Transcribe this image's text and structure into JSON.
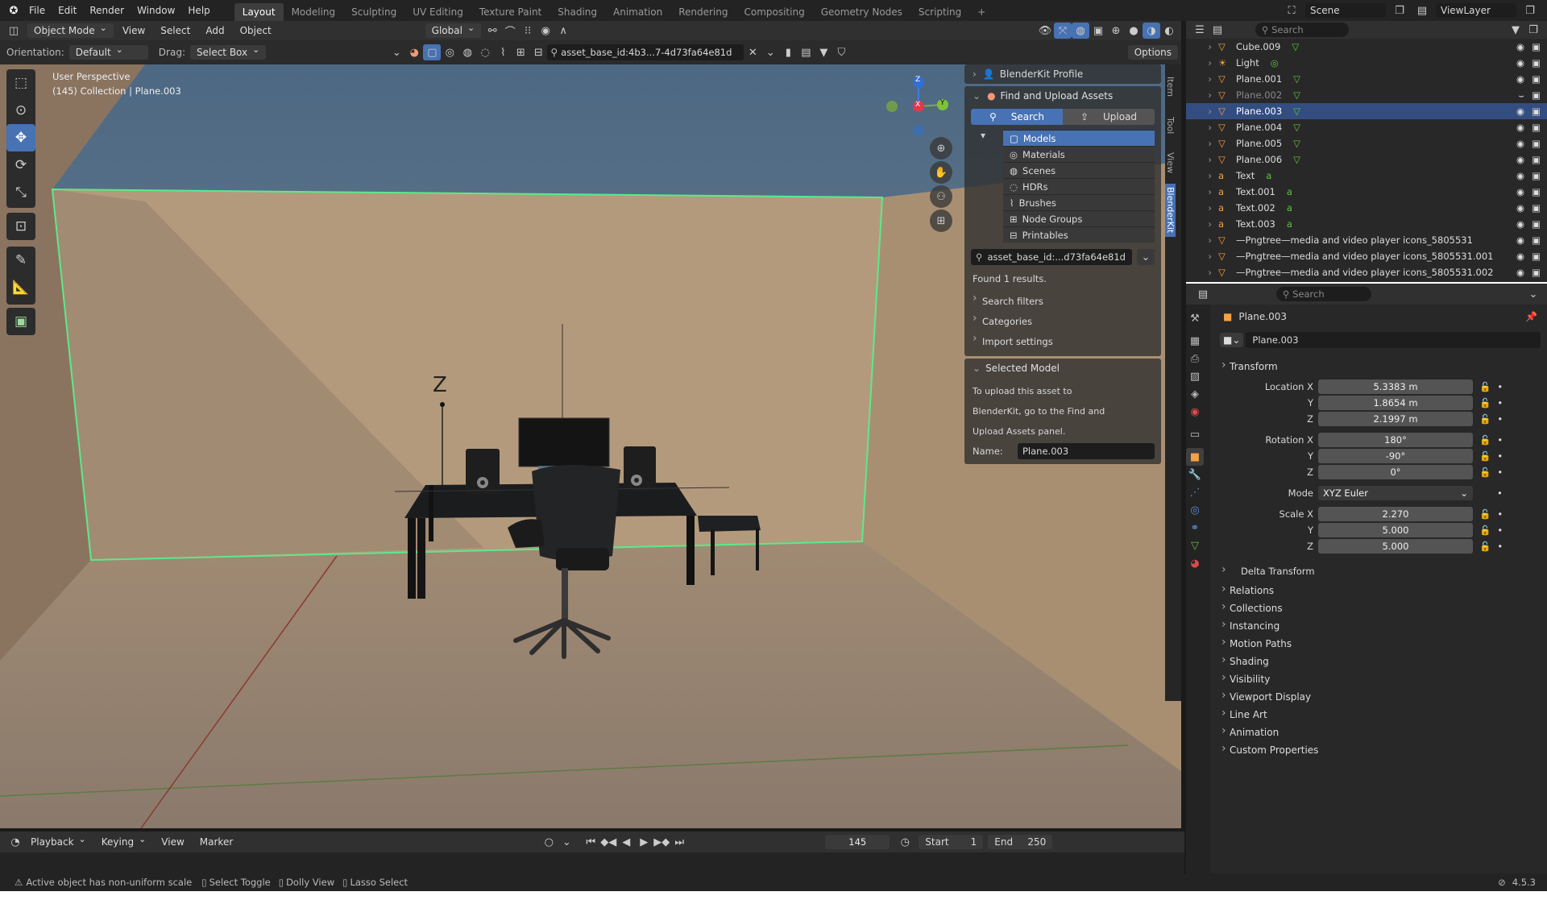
{
  "topbar": {
    "menus": [
      "File",
      "Edit",
      "Render",
      "Window",
      "Help"
    ],
    "workspaces": [
      "Layout",
      "Modeling",
      "Sculpting",
      "UV Editing",
      "Texture Paint",
      "Shading",
      "Animation",
      "Rendering",
      "Compositing",
      "Geometry Nodes",
      "Scripting"
    ],
    "active_workspace": "Layout",
    "add_tab": "+",
    "scene_label": "Scene",
    "viewlayer_label": "ViewLayer"
  },
  "viewport_header": {
    "mode": "Object Mode",
    "menus": [
      "View",
      "Select",
      "Add",
      "Object"
    ],
    "transform_orientation": "Global",
    "orientation_label": "Orientation:",
    "orientation_value": "Default",
    "drag_label": "Drag:",
    "drag_value": "Select Box",
    "search_text": "asset_base_id:4b3...7-4d73fa64e81d",
    "options": "Options"
  },
  "viewport": {
    "perspective": "User Perspective",
    "collection_info": "(145) Collection | Plane.003",
    "z_label": "Z",
    "gizmo_x": "X",
    "gizmo_y": "Y",
    "gizmo_z": "Z"
  },
  "sidebar_tabs": [
    "Item",
    "Tool",
    "View",
    "BlenderKit"
  ],
  "blenderkit": {
    "profile_label": "BlenderKit Profile",
    "find_upload_label": "Find and Upload Assets",
    "search_tab": "Search",
    "upload_tab": "Upload",
    "categories": [
      "Models",
      "Materials",
      "Scenes",
      "HDRs",
      "Brushes",
      "Node Groups",
      "Printables"
    ],
    "active_category": "Models",
    "search_value": "asset_base_id:...d73fa64e81d",
    "results_text": "Found 1 results.",
    "search_filters": "Search filters",
    "categories_label": "Categories",
    "import_settings": "Import settings",
    "selected_model_label": "Selected Model",
    "upload_info_1": "To upload this asset to",
    "upload_info_2": "BlenderKit, go to the Find and",
    "upload_info_3": "Upload Assets panel.",
    "name_label": "Name:",
    "name_value": "Plane.003"
  },
  "outliner": {
    "search_placeholder": "Search",
    "items": [
      {
        "name": "Cube.009",
        "type": "mesh"
      },
      {
        "name": "Light",
        "type": "light"
      },
      {
        "name": "Plane.001",
        "type": "mesh"
      },
      {
        "name": "Plane.002",
        "type": "mesh",
        "dim": true
      },
      {
        "name": "Plane.003",
        "type": "mesh",
        "selected": true
      },
      {
        "name": "Plane.004",
        "type": "mesh"
      },
      {
        "name": "Plane.005",
        "type": "mesh"
      },
      {
        "name": "Plane.006",
        "type": "mesh"
      },
      {
        "name": "Text",
        "type": "text"
      },
      {
        "name": "Text.001",
        "type": "text"
      },
      {
        "name": "Text.002",
        "type": "text"
      },
      {
        "name": "Text.003",
        "type": "text"
      },
      {
        "name": "—Pngtree—media and video player icons_5805531",
        "type": "mesh"
      },
      {
        "name": "—Pngtree—media and video player icons_5805531.001",
        "type": "mesh"
      },
      {
        "name": "—Pngtree—media and video player icons_5805531.002",
        "type": "mesh"
      }
    ]
  },
  "properties": {
    "search_placeholder": "Search",
    "object_name": "Plane.003",
    "object_field": "Plane.003",
    "transform_label": "Transform",
    "location_label": "Location X",
    "location": [
      "5.3383 m",
      "1.8654 m",
      "2.1997 m"
    ],
    "rotation_label": "Rotation X",
    "rotation": [
      "180°",
      "-90°",
      "0°"
    ],
    "axis_y": "Y",
    "axis_z": "Z",
    "mode_label": "Mode",
    "mode_value": "XYZ Euler",
    "scale_label": "Scale X",
    "scale": [
      "2.270",
      "5.000",
      "5.000"
    ],
    "delta_transform": "Delta Transform",
    "sections": [
      "Relations",
      "Collections",
      "Instancing",
      "Motion Paths",
      "Shading",
      "Visibility",
      "Viewport Display",
      "Line Art",
      "Animation",
      "Custom Properties"
    ]
  },
  "timeline": {
    "menus": [
      "Playback",
      "Keying",
      "View",
      "Marker"
    ],
    "current_frame": "145",
    "start_label": "Start",
    "start": "1",
    "end_label": "End",
    "end": "250"
  },
  "statusbar": {
    "warning": "Active object has non-uniform scale",
    "hint1": "Select Toggle",
    "hint2": "Dolly View",
    "hint3": "Lasso Select",
    "version": "4.5.3"
  },
  "colors": {
    "accent": "#4772b3",
    "selection_outline": "#5bea8a",
    "wall": "#b0977a",
    "sky_top": "#4f6a85"
  }
}
